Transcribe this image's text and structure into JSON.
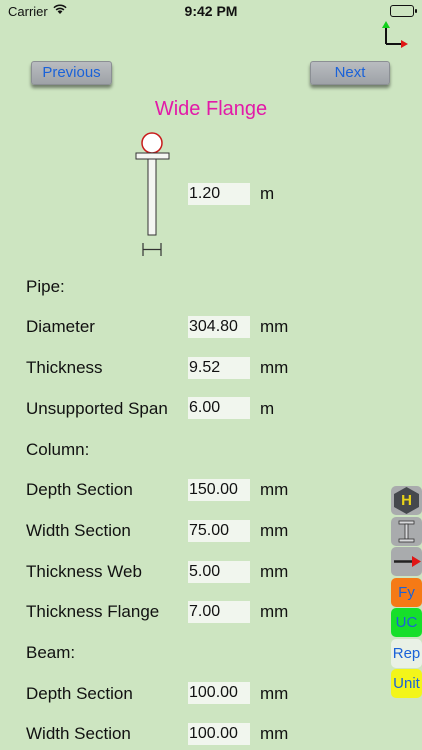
{
  "status": {
    "carrier": "Carrier",
    "time": "9:42 PM"
  },
  "nav": {
    "previous": "Previous",
    "next": "Next"
  },
  "title": "Wide Flange",
  "diagram_row": {
    "value": "1.20",
    "unit": "m"
  },
  "pipe": {
    "heading": "Pipe:",
    "rows": [
      {
        "label": "Diameter",
        "value": "304.80",
        "unit": "mm"
      },
      {
        "label": "Thickness",
        "value": "9.52",
        "unit": "mm"
      },
      {
        "label": "Unsupported Span",
        "value": "6.00",
        "unit": "m"
      }
    ]
  },
  "column": {
    "heading": "Column:",
    "rows": [
      {
        "label": "Depth Section",
        "value": "150.00",
        "unit": "mm"
      },
      {
        "label": "Width Section",
        "value": "75.00",
        "unit": "mm"
      },
      {
        "label": "Thickness Web",
        "value": "5.00",
        "unit": "mm"
      },
      {
        "label": "Thickness Flange",
        "value": "7.00",
        "unit": "mm"
      }
    ]
  },
  "beam": {
    "heading": "Beam:",
    "rows": [
      {
        "label": "Depth Section",
        "value": "100.00",
        "unit": "mm"
      },
      {
        "label": "Width Section",
        "value": "100.00",
        "unit": "mm"
      }
    ]
  },
  "side_toolbar": {
    "h_label": "H",
    "fy_label": "Fy",
    "uc_label": "UC",
    "rep_label": "Rep",
    "unit_label": "Unit",
    "colors": {
      "fy": "#f57a16",
      "uc": "#16df2a",
      "rep": "#e9f1e6",
      "unit": "#f3f51a"
    }
  },
  "colors": {
    "background": "#cde5c1",
    "title": "#e21aa8",
    "link": "#1a62d8"
  }
}
